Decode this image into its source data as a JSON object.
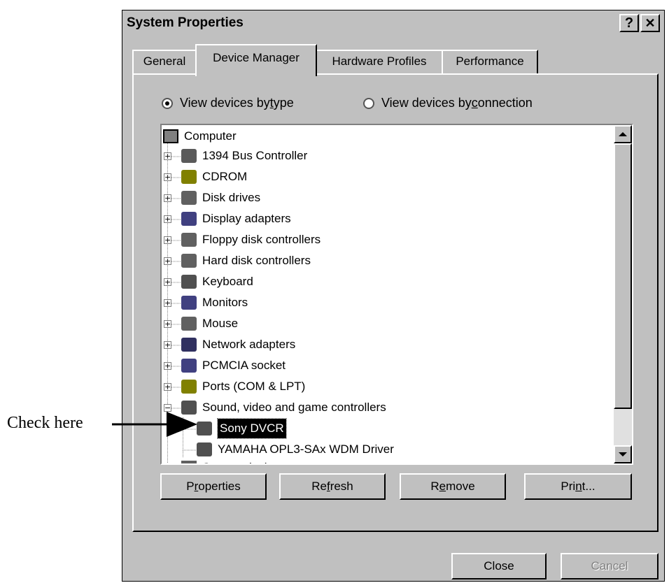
{
  "annotation": {
    "label": "Check here"
  },
  "window": {
    "title": "System Properties",
    "help_label": "?",
    "close_label": "✕"
  },
  "tabs": [
    {
      "label": "General"
    },
    {
      "label": "Device Manager"
    },
    {
      "label": "Hardware Profiles"
    },
    {
      "label": "Performance"
    }
  ],
  "view_options": {
    "by_type": {
      "prefix": "View devices by ",
      "key": "t",
      "suffix": "ype",
      "selected": true
    },
    "by_connection": {
      "prefix": "View devices by ",
      "key": "c",
      "suffix": "onnection",
      "selected": false
    }
  },
  "tree": {
    "root": {
      "label": "Computer",
      "icon": "computer-icon"
    },
    "items": [
      {
        "label": "1394 Bus Controller",
        "icon": "bus-controller-icon"
      },
      {
        "label": "CDROM",
        "icon": "cdrom-icon"
      },
      {
        "label": "Disk drives",
        "icon": "disk-drive-icon"
      },
      {
        "label": "Display adapters",
        "icon": "display-adapter-icon"
      },
      {
        "label": "Floppy disk controllers",
        "icon": "floppy-controller-icon"
      },
      {
        "label": "Hard disk controllers",
        "icon": "hard-disk-controller-icon"
      },
      {
        "label": "Keyboard",
        "icon": "keyboard-icon"
      },
      {
        "label": "Monitors",
        "icon": "monitor-icon"
      },
      {
        "label": "Mouse",
        "icon": "mouse-icon"
      },
      {
        "label": "Network adapters",
        "icon": "network-adapter-icon"
      },
      {
        "label": "PCMCIA socket",
        "icon": "pcmcia-icon"
      },
      {
        "label": "Ports (COM & LPT)",
        "icon": "ports-icon"
      },
      {
        "label": "Sound, video and game controllers",
        "icon": "sound-video-icon",
        "expanded": true
      }
    ],
    "children": [
      {
        "label": "Sony DVCR",
        "icon": "sound-video-icon",
        "selected": true
      },
      {
        "label": "YAMAHA OPL3-SAx WDM Driver",
        "icon": "sound-video-icon"
      }
    ],
    "partial": {
      "label": "System devices",
      "icon": "system-devices-icon"
    }
  },
  "actions": {
    "properties": {
      "pre": "P",
      "key": "r",
      "post": "operties"
    },
    "refresh": {
      "pre": "Re",
      "key": "f",
      "post": "resh"
    },
    "remove": {
      "pre": "R",
      "key": "e",
      "post": "move"
    },
    "print": {
      "pre": "Pri",
      "key": "n",
      "post": "t..."
    }
  },
  "footer": {
    "close": "Close",
    "cancel": "Cancel"
  },
  "colors": {
    "dialog": "#c0c0c0",
    "selection": "#000000",
    "list_bg": "#ffffff"
  }
}
